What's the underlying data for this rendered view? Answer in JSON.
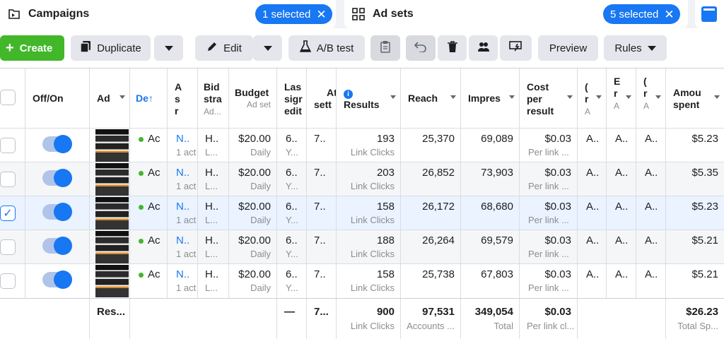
{
  "tabs": {
    "campaigns": {
      "title": "Campaigns",
      "selected": "1 selected"
    },
    "adsets": {
      "title": "Ad sets",
      "selected": "5 selected"
    }
  },
  "toolbar": {
    "create": "Create",
    "duplicate": "Duplicate",
    "edit": "Edit",
    "ab_test": "A/B test",
    "preview": "Preview",
    "rules": "Rules"
  },
  "columns": {
    "offon": "Off/On",
    "ad": "Ad",
    "delivery": "De",
    "ad_set_a": "A",
    "ad_set_s": "s",
    "ad_set_r": "r",
    "bid_1": "Bid",
    "bid_2": "stra",
    "bid_sub": "Ad...",
    "budget": "Budget",
    "budget_sub": "Ad set",
    "last_1": "Las",
    "last_2": "sigr",
    "last_3": "edit",
    "attr_1": "Att",
    "attr_2": "sett",
    "results": "Results",
    "reach": "Reach",
    "impressions": "Impres",
    "cost_1": "Cost",
    "cost_2": "per",
    "cost_3": "result",
    "q1": "(",
    "q1b": "r",
    "q1c": "A",
    "q2": "E",
    "q2b": "r",
    "q2c": "A",
    "q3": "(",
    "q3b": "r",
    "q3c": "A",
    "amount_1": "Amou",
    "amount_2": "spent"
  },
  "rows": [
    {
      "selected": false,
      "delivery": "Ac",
      "adset": "N..",
      "adset_sub": "1 act",
      "bid": "H..",
      "bid_sub": "L...",
      "budget": "$20.00",
      "budget_sub": "Daily",
      "last": "6..",
      "last_sub": "Y...",
      "attr": "7..",
      "results": "193",
      "results_sub": "Link Clicks",
      "reach": "25,370",
      "impressions": "69,089",
      "cost": "$0.03",
      "cost_sub": "Per link ...",
      "c1": "A..",
      "c2": "A..",
      "c3": "A..",
      "amount": "$5.23"
    },
    {
      "selected": false,
      "delivery": "Ac",
      "adset": "N..",
      "adset_sub": "1 act",
      "bid": "H..",
      "bid_sub": "L...",
      "budget": "$20.00",
      "budget_sub": "Daily",
      "last": "6..",
      "last_sub": "Y...",
      "attr": "7..",
      "results": "203",
      "results_sub": "Link Clicks",
      "reach": "26,852",
      "impressions": "73,903",
      "cost": "$0.03",
      "cost_sub": "Per link ...",
      "c1": "A..",
      "c2": "A..",
      "c3": "A..",
      "amount": "$5.35"
    },
    {
      "selected": true,
      "delivery": "Ac",
      "adset": "N..",
      "adset_sub": "1 act",
      "bid": "H..",
      "bid_sub": "L...",
      "budget": "$20.00",
      "budget_sub": "Daily",
      "last": "6..",
      "last_sub": "Y...",
      "attr": "7..",
      "results": "158",
      "results_sub": "Link Clicks",
      "reach": "26,172",
      "impressions": "68,680",
      "cost": "$0.03",
      "cost_sub": "Per link ...",
      "c1": "A..",
      "c2": "A..",
      "c3": "A..",
      "amount": "$5.23"
    },
    {
      "selected": false,
      "delivery": "Ac",
      "adset": "N..",
      "adset_sub": "1 act",
      "bid": "H..",
      "bid_sub": "L...",
      "budget": "$20.00",
      "budget_sub": "Daily",
      "last": "6..",
      "last_sub": "Y...",
      "attr": "7..",
      "results": "188",
      "results_sub": "Link Clicks",
      "reach": "26,264",
      "impressions": "69,579",
      "cost": "$0.03",
      "cost_sub": "Per link ...",
      "c1": "A..",
      "c2": "A..",
      "c3": "A..",
      "amount": "$5.21"
    },
    {
      "selected": false,
      "delivery": "Ac",
      "adset": "N..",
      "adset_sub": "1 act",
      "bid": "H..",
      "bid_sub": "L...",
      "budget": "$20.00",
      "budget_sub": "Daily",
      "last": "6..",
      "last_sub": "Y...",
      "attr": "7..",
      "results": "158",
      "results_sub": "Link Clicks",
      "reach": "25,738",
      "impressions": "67,803",
      "cost": "$0.03",
      "cost_sub": "Per link ...",
      "c1": "A..",
      "c2": "A..",
      "c3": "A..",
      "amount": "$5.21"
    }
  ],
  "totals": {
    "label": "Res...",
    "last": "—",
    "attr": "7...",
    "results": "900",
    "results_sub": "Link Clicks",
    "reach": "97,531",
    "reach_sub": "Accounts ...",
    "impressions": "349,054",
    "impressions_sub": "Total",
    "cost": "$0.03",
    "cost_sub": "Per link cl...",
    "amount": "$26.23",
    "amount_sub": "Total Sp..."
  },
  "colors": {
    "accent": "#1877f2",
    "create": "#42b72a",
    "delivery_dot": "#42b72a"
  }
}
